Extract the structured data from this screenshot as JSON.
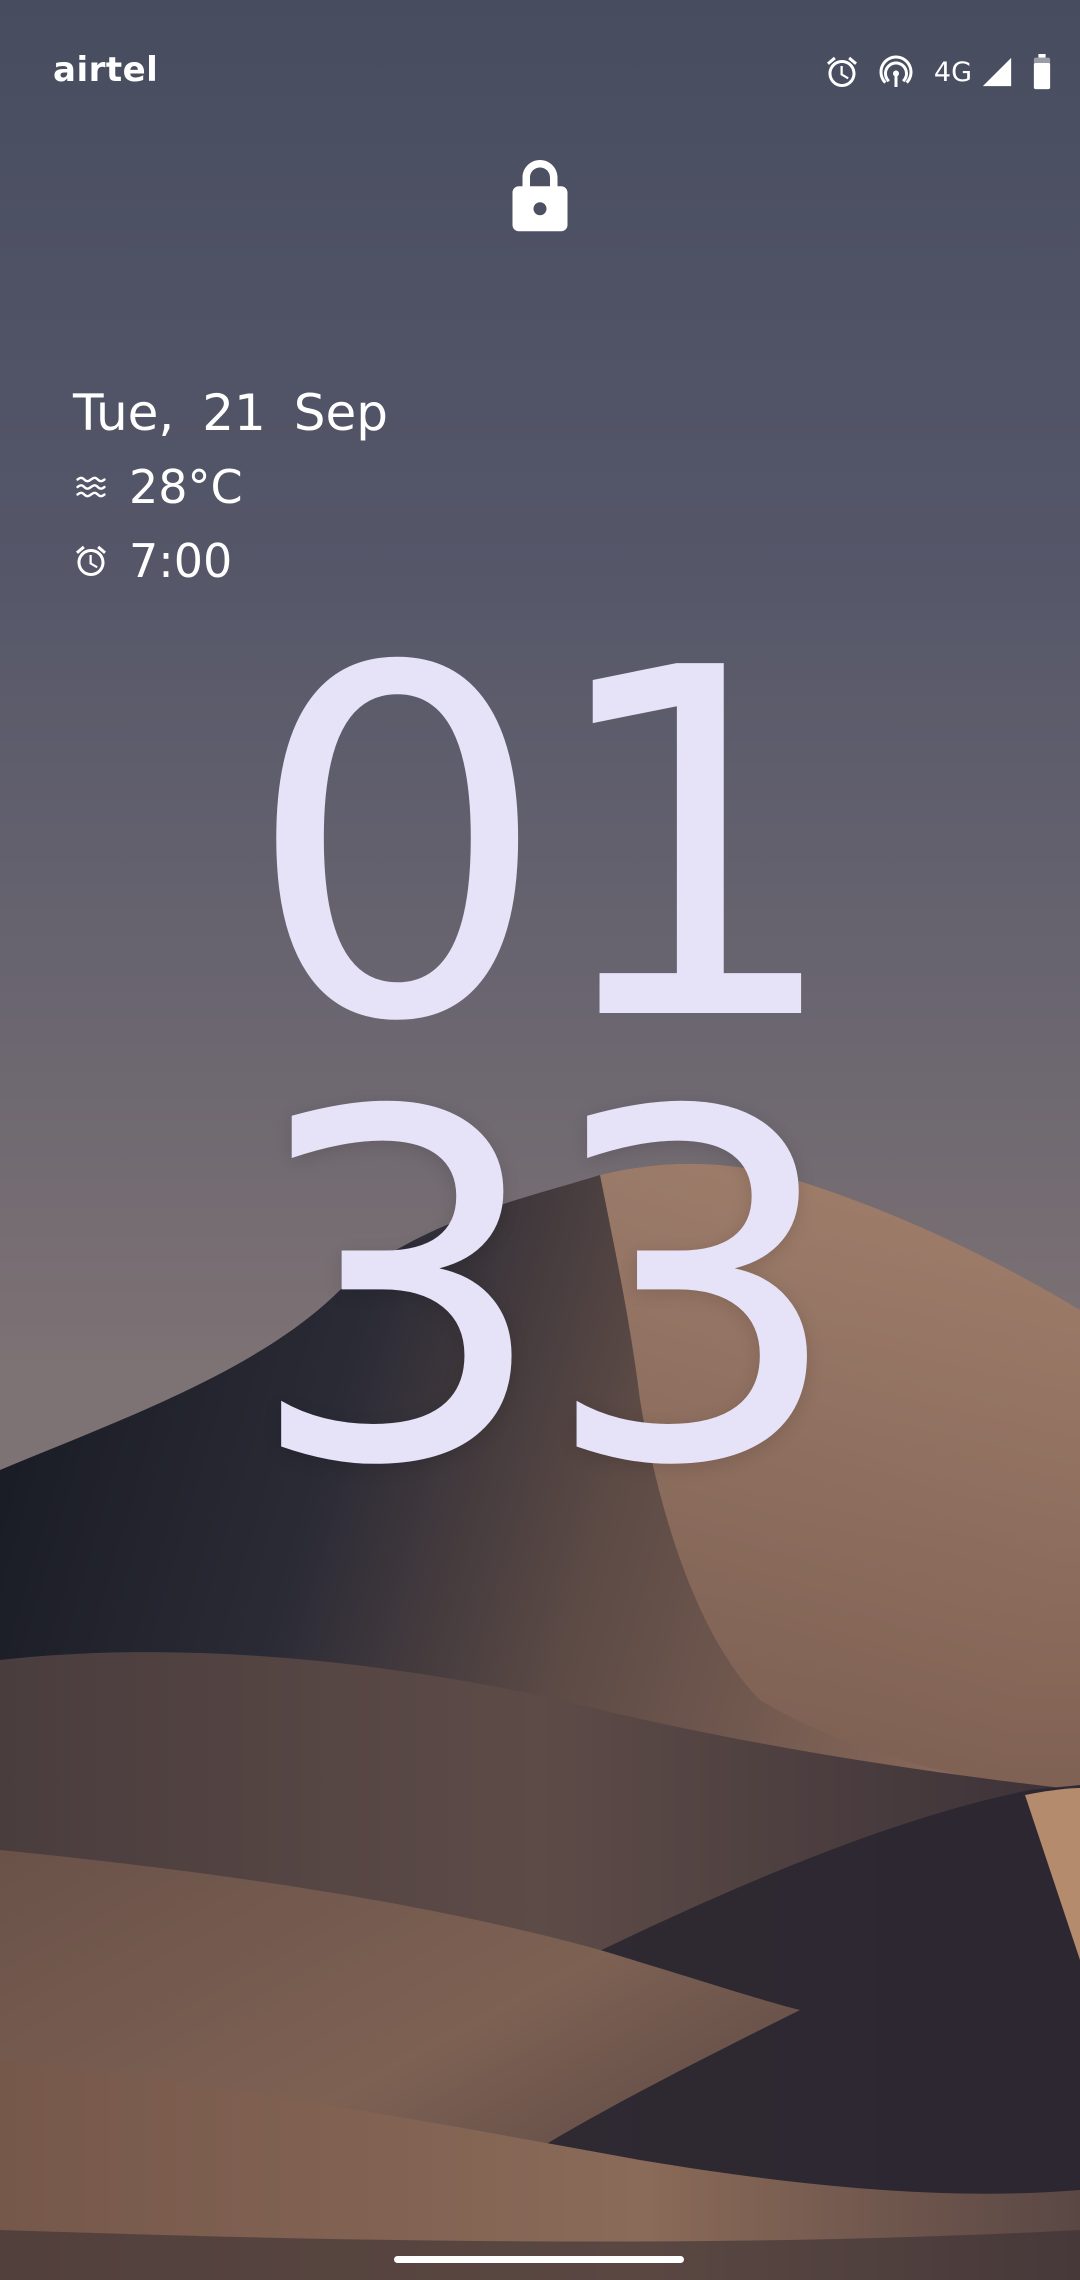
{
  "status_bar": {
    "carrier": "airtel",
    "network_type": "4G",
    "icons": [
      "alarm-icon",
      "hotspot-icon",
      "signal-icon",
      "battery-icon"
    ]
  },
  "lock": {
    "icon": "lock-icon"
  },
  "smartspace": {
    "date": "Tue, 21 Sep",
    "weather_icon": "haze-icon",
    "temperature": "28°C",
    "alarm_icon": "alarm-icon",
    "alarm_time": "7:00"
  },
  "clock": {
    "hours": "01",
    "minutes": "33"
  },
  "colors": {
    "sky_top": "#474d5f",
    "sky_bottom": "#7a7175",
    "clock": "#e6e2f7",
    "dune_light": "#a7826a",
    "dune_dark": "#1e2230"
  }
}
